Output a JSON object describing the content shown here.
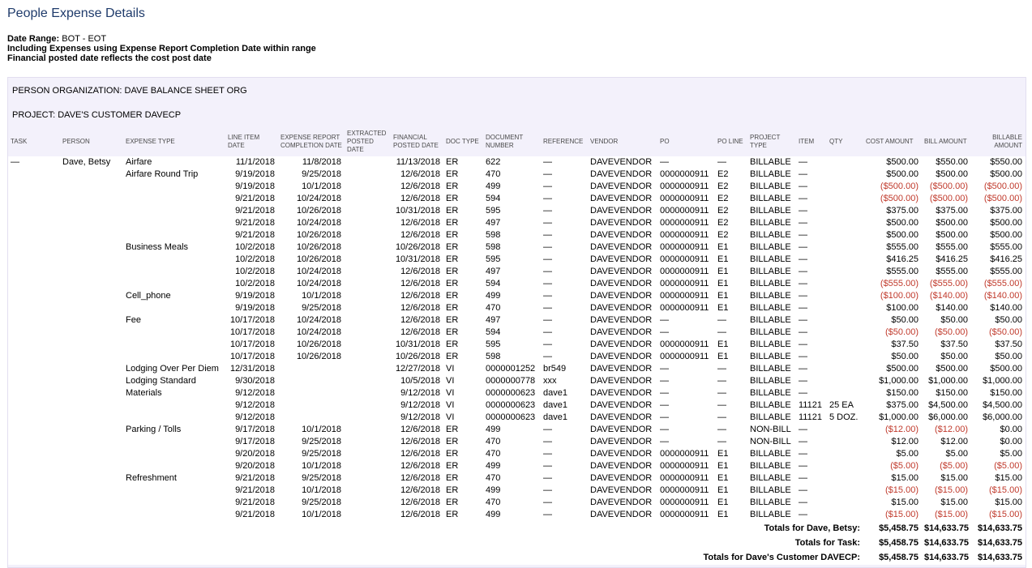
{
  "report": {
    "title": "People Expense Details",
    "date_range_label": "Date Range:",
    "date_range_value": "BOT - EOT",
    "note1": "Including Expenses using Expense Report Completion Date within range",
    "note2": "Financial posted date reflects the cost post date"
  },
  "group": {
    "org": "PERSON ORGANIZATION:  DAVE BALANCE SHEET ORG",
    "project": "PROJECT:  DAVE'S CUSTOMER DAVECP"
  },
  "columns": [
    {
      "key": "task",
      "label": "TASK"
    },
    {
      "key": "person",
      "label": "PERSON"
    },
    {
      "key": "expense_type",
      "label": "EXPENSE TYPE"
    },
    {
      "key": "line_date",
      "label": "LINE ITEM DATE"
    },
    {
      "key": "completion",
      "label": "EXPENSE REPORT COMPLETION DATE"
    },
    {
      "key": "extracted",
      "label": "EXTRACTED POSTED DATE"
    },
    {
      "key": "financial",
      "label": "FINANCIAL POSTED DATE"
    },
    {
      "key": "doc_type",
      "label": "DOC TYPE"
    },
    {
      "key": "doc_num",
      "label": "DOCUMENT NUMBER"
    },
    {
      "key": "reference",
      "label": "REFERENCE"
    },
    {
      "key": "vendor",
      "label": "VENDOR"
    },
    {
      "key": "po",
      "label": "PO"
    },
    {
      "key": "po_line",
      "label": "PO LINE"
    },
    {
      "key": "project_type",
      "label": "PROJECT TYPE"
    },
    {
      "key": "item",
      "label": "ITEM"
    },
    {
      "key": "qty",
      "label": "QTY"
    },
    {
      "key": "cost",
      "label": "COST AMOUNT"
    },
    {
      "key": "bill",
      "label": "BILL AMOUNT"
    },
    {
      "key": "billable",
      "label": "BILLABLE AMOUNT"
    }
  ],
  "rows": [
    [
      "—",
      "Dave, Betsy",
      "Airfare",
      "11/1/2018",
      "11/8/2018",
      "",
      "11/13/2018",
      "ER",
      "622",
      "—",
      "DAVEVENDOR",
      "—",
      "—",
      "BILLABLE",
      "—",
      "",
      "$500.00",
      "$550.00",
      "$550.00"
    ],
    [
      "",
      "",
      "Airfare Round Trip",
      "9/19/2018",
      "9/25/2018",
      "",
      "12/6/2018",
      "ER",
      "470",
      "—",
      "DAVEVENDOR",
      "0000000911",
      "E2",
      "BILLABLE",
      "—",
      "",
      "$500.00",
      "$500.00",
      "$500.00"
    ],
    [
      "",
      "",
      "",
      "9/19/2018",
      "10/1/2018",
      "",
      "12/6/2018",
      "ER",
      "499",
      "—",
      "DAVEVENDOR",
      "0000000911",
      "E2",
      "BILLABLE",
      "—",
      "",
      "($500.00)",
      "($500.00)",
      "($500.00)"
    ],
    [
      "",
      "",
      "",
      "9/21/2018",
      "10/24/2018",
      "",
      "12/6/2018",
      "ER",
      "594",
      "—",
      "DAVEVENDOR",
      "0000000911",
      "E2",
      "BILLABLE",
      "—",
      "",
      "($500.00)",
      "($500.00)",
      "($500.00)"
    ],
    [
      "",
      "",
      "",
      "9/21/2018",
      "10/26/2018",
      "",
      "10/31/2018",
      "ER",
      "595",
      "—",
      "DAVEVENDOR",
      "0000000911",
      "E2",
      "BILLABLE",
      "—",
      "",
      "$375.00",
      "$375.00",
      "$375.00"
    ],
    [
      "",
      "",
      "",
      "9/21/2018",
      "10/24/2018",
      "",
      "12/6/2018",
      "ER",
      "497",
      "—",
      "DAVEVENDOR",
      "0000000911",
      "E2",
      "BILLABLE",
      "—",
      "",
      "$500.00",
      "$500.00",
      "$500.00"
    ],
    [
      "",
      "",
      "",
      "9/21/2018",
      "10/26/2018",
      "",
      "12/6/2018",
      "ER",
      "598",
      "—",
      "DAVEVENDOR",
      "0000000911",
      "E2",
      "BILLABLE",
      "—",
      "",
      "$500.00",
      "$500.00",
      "$500.00"
    ],
    [
      "",
      "",
      "Business Meals",
      "10/2/2018",
      "10/26/2018",
      "",
      "10/26/2018",
      "ER",
      "598",
      "—",
      "DAVEVENDOR",
      "0000000911",
      "E1",
      "BILLABLE",
      "—",
      "",
      "$555.00",
      "$555.00",
      "$555.00"
    ],
    [
      "",
      "",
      "",
      "10/2/2018",
      "10/26/2018",
      "",
      "10/31/2018",
      "ER",
      "595",
      "—",
      "DAVEVENDOR",
      "0000000911",
      "E1",
      "BILLABLE",
      "—",
      "",
      "$416.25",
      "$416.25",
      "$416.25"
    ],
    [
      "",
      "",
      "",
      "10/2/2018",
      "10/24/2018",
      "",
      "12/6/2018",
      "ER",
      "497",
      "—",
      "DAVEVENDOR",
      "0000000911",
      "E1",
      "BILLABLE",
      "—",
      "",
      "$555.00",
      "$555.00",
      "$555.00"
    ],
    [
      "",
      "",
      "",
      "10/2/2018",
      "10/24/2018",
      "",
      "12/6/2018",
      "ER",
      "594",
      "—",
      "DAVEVENDOR",
      "0000000911",
      "E1",
      "BILLABLE",
      "—",
      "",
      "($555.00)",
      "($555.00)",
      "($555.00)"
    ],
    [
      "",
      "",
      "Cell_phone",
      "9/19/2018",
      "10/1/2018",
      "",
      "12/6/2018",
      "ER",
      "499",
      "—",
      "DAVEVENDOR",
      "0000000911",
      "E1",
      "BILLABLE",
      "—",
      "",
      "($100.00)",
      "($140.00)",
      "($140.00)"
    ],
    [
      "",
      "",
      "",
      "9/19/2018",
      "9/25/2018",
      "",
      "12/6/2018",
      "ER",
      "470",
      "—",
      "DAVEVENDOR",
      "0000000911",
      "E1",
      "BILLABLE",
      "—",
      "",
      "$100.00",
      "$140.00",
      "$140.00"
    ],
    [
      "",
      "",
      "Fee",
      "10/17/2018",
      "10/24/2018",
      "",
      "12/6/2018",
      "ER",
      "497",
      "—",
      "DAVEVENDOR",
      "—",
      "—",
      "BILLABLE",
      "—",
      "",
      "$50.00",
      "$50.00",
      "$50.00"
    ],
    [
      "",
      "",
      "",
      "10/17/2018",
      "10/24/2018",
      "",
      "12/6/2018",
      "ER",
      "594",
      "—",
      "DAVEVENDOR",
      "—",
      "—",
      "BILLABLE",
      "—",
      "",
      "($50.00)",
      "($50.00)",
      "($50.00)"
    ],
    [
      "",
      "",
      "",
      "10/17/2018",
      "10/26/2018",
      "",
      "10/31/2018",
      "ER",
      "595",
      "—",
      "DAVEVENDOR",
      "0000000911",
      "E1",
      "BILLABLE",
      "—",
      "",
      "$37.50",
      "$37.50",
      "$37.50"
    ],
    [
      "",
      "",
      "",
      "10/17/2018",
      "10/26/2018",
      "",
      "10/26/2018",
      "ER",
      "598",
      "—",
      "DAVEVENDOR",
      "0000000911",
      "E1",
      "BILLABLE",
      "—",
      "",
      "$50.00",
      "$50.00",
      "$50.00"
    ],
    [
      "",
      "",
      "Lodging Over Per Diem",
      "12/31/2018",
      "",
      "",
      "12/27/2018",
      "VI",
      "0000001252",
      "br549",
      "DAVEVENDOR",
      "—",
      "—",
      "BILLABLE",
      "—",
      "",
      "$500.00",
      "$500.00",
      "$500.00"
    ],
    [
      "",
      "",
      "Lodging Standard",
      "9/30/2018",
      "",
      "",
      "10/5/2018",
      "VI",
      "0000000778",
      "xxx",
      "DAVEVENDOR",
      "—",
      "—",
      "BILLABLE",
      "—",
      "",
      "$1,000.00",
      "$1,000.00",
      "$1,000.00"
    ],
    [
      "",
      "",
      "Materials",
      "9/12/2018",
      "",
      "",
      "9/12/2018",
      "VI",
      "0000000623",
      "dave1",
      "DAVEVENDOR",
      "—",
      "—",
      "BILLABLE",
      "—",
      "",
      "$150.00",
      "$150.00",
      "$150.00"
    ],
    [
      "",
      "",
      "",
      "9/12/2018",
      "",
      "",
      "9/12/2018",
      "VI",
      "0000000623",
      "dave1",
      "DAVEVENDOR",
      "—",
      "—",
      "BILLABLE",
      "11121",
      "25 EA",
      "$375.00",
      "$4,500.00",
      "$4,500.00"
    ],
    [
      "",
      "",
      "",
      "9/12/2018",
      "",
      "",
      "9/12/2018",
      "VI",
      "0000000623",
      "dave1",
      "DAVEVENDOR",
      "—",
      "—",
      "BILLABLE",
      "11121",
      "5 DOZ.",
      "$1,000.00",
      "$6,000.00",
      "$6,000.00"
    ],
    [
      "",
      "",
      "Parking / Tolls",
      "9/17/2018",
      "10/1/2018",
      "",
      "12/6/2018",
      "ER",
      "499",
      "—",
      "DAVEVENDOR",
      "—",
      "—",
      "NON-BILL",
      "—",
      "",
      "($12.00)",
      "($12.00)",
      "$0.00"
    ],
    [
      "",
      "",
      "",
      "9/17/2018",
      "9/25/2018",
      "",
      "12/6/2018",
      "ER",
      "470",
      "—",
      "DAVEVENDOR",
      "—",
      "—",
      "NON-BILL",
      "—",
      "",
      "$12.00",
      "$12.00",
      "$0.00"
    ],
    [
      "",
      "",
      "",
      "9/20/2018",
      "9/25/2018",
      "",
      "12/6/2018",
      "ER",
      "470",
      "—",
      "DAVEVENDOR",
      "0000000911",
      "E1",
      "BILLABLE",
      "—",
      "",
      "$5.00",
      "$5.00",
      "$5.00"
    ],
    [
      "",
      "",
      "",
      "9/20/2018",
      "10/1/2018",
      "",
      "12/6/2018",
      "ER",
      "499",
      "—",
      "DAVEVENDOR",
      "0000000911",
      "E1",
      "BILLABLE",
      "—",
      "",
      "($5.00)",
      "($5.00)",
      "($5.00)"
    ],
    [
      "",
      "",
      "Refreshment",
      "9/21/2018",
      "9/25/2018",
      "",
      "12/6/2018",
      "ER",
      "470",
      "—",
      "DAVEVENDOR",
      "0000000911",
      "E1",
      "BILLABLE",
      "—",
      "",
      "$15.00",
      "$15.00",
      "$15.00"
    ],
    [
      "",
      "",
      "",
      "9/21/2018",
      "10/1/2018",
      "",
      "12/6/2018",
      "ER",
      "499",
      "—",
      "DAVEVENDOR",
      "0000000911",
      "E1",
      "BILLABLE",
      "—",
      "",
      "($15.00)",
      "($15.00)",
      "($15.00)"
    ],
    [
      "",
      "",
      "",
      "9/21/2018",
      "9/25/2018",
      "",
      "12/6/2018",
      "ER",
      "470",
      "—",
      "DAVEVENDOR",
      "0000000911",
      "E1",
      "BILLABLE",
      "—",
      "",
      "$15.00",
      "$15.00",
      "$15.00"
    ],
    [
      "",
      "",
      "",
      "9/21/2018",
      "10/1/2018",
      "",
      "12/6/2018",
      "ER",
      "499",
      "—",
      "DAVEVENDOR",
      "0000000911",
      "E1",
      "BILLABLE",
      "—",
      "",
      "($15.00)",
      "($15.00)",
      "($15.00)"
    ]
  ],
  "totals": [
    {
      "label": "Totals for Dave, Betsy:",
      "cost": "$5,458.75",
      "bill": "$14,633.75",
      "billable": "$14,633.75"
    },
    {
      "label": "Totals for Task:",
      "cost": "$5,458.75",
      "bill": "$14,633.75",
      "billable": "$14,633.75"
    },
    {
      "label": "Totals for Dave's Customer DAVECP:",
      "cost": "$5,458.75",
      "bill": "$14,633.75",
      "billable": "$14,633.75"
    }
  ],
  "colors": {
    "negative": "#c0392b",
    "title": "#1f3b6b",
    "panel": "#f3f1fb"
  }
}
